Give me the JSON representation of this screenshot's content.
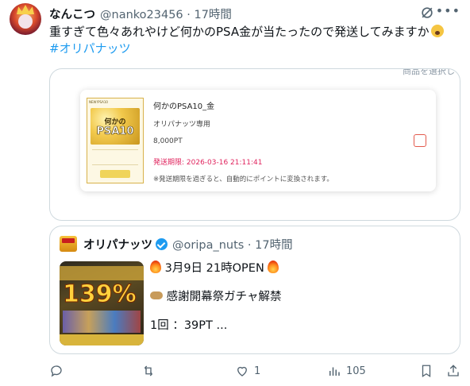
{
  "tweet": {
    "display_name": "なんこつ",
    "meta": "@nanko23456 · 17時間",
    "text": "重すぎて色々あれやけど何かのPSA金が当たったので発送してみますか",
    "hashtag": "#オリパナッツ"
  },
  "media": {
    "cropped_text": "商品を選択し",
    "card": {
      "title": "何かのPSA10_金",
      "subtitle": "オリパナッツ専用",
      "price": "8,000PT",
      "deadline": "発送期限: 2026-03-16 21:11:41",
      "note": "※発送期限を過ぎると、自動的にポイントに変換されます。",
      "image_top": "NEW!PSA10",
      "image_line1": "何かの",
      "image_line2": "PSA10",
      "checkbox_checked": false
    }
  },
  "quote": {
    "display_name": "オリパナッツ",
    "meta": "@oripa_nuts · 17時間",
    "thumb_pct": "139%",
    "line1": "3月9日 21時OPEN",
    "line2": "感謝開幕祭ガチャ解禁",
    "line3": "1回 ：39PT ..."
  },
  "actions": {
    "replies": "",
    "reposts": "",
    "likes": "1",
    "views": "105"
  },
  "colors": {
    "accent": "#1d9bf0",
    "text": "#0f1419",
    "muted": "#536471",
    "deadline": "#e0245e",
    "border": "#cfd9de"
  }
}
